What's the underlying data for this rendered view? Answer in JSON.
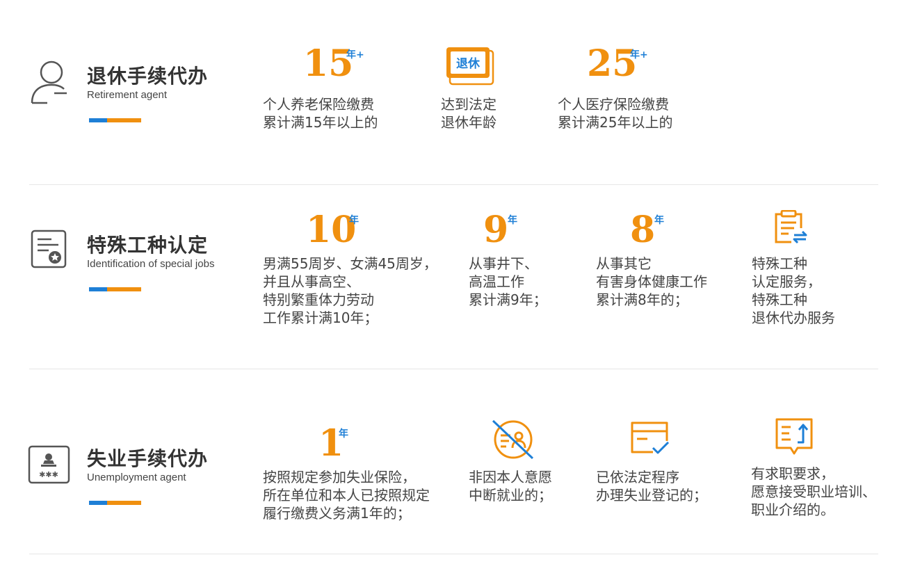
{
  "colors": {
    "orange": "#f0900f",
    "blue": "#1e7fd6",
    "icon_gray": "#555555"
  },
  "sections": [
    {
      "title": "退休手续代办",
      "subtitle": "Retirement agent",
      "icon": "person-minus-icon",
      "features": [
        {
          "number": "15",
          "suffix": "年+",
          "lines": [
            "个人养老保险缴费",
            "累计满15年以上的"
          ]
        },
        {
          "icon": "retirement-card-icon",
          "icon_text": "退休",
          "lines": [
            "达到法定",
            "退休年龄"
          ]
        },
        {
          "number": "25",
          "suffix": "年+",
          "lines": [
            "个人医疗保险缴费",
            "累计满25年以上的"
          ]
        }
      ]
    },
    {
      "title": "特殊工种认定",
      "subtitle": "Identification of special jobs",
      "icon": "certificate-star-icon",
      "features": [
        {
          "number": "10",
          "suffix": "年",
          "lines": [
            "男满55周岁、女满45周岁，",
            "并且从事高空、",
            "特别繁重体力劳动",
            "工作累计满10年；"
          ]
        },
        {
          "number": "9",
          "suffix": "年",
          "lines": [
            "从事井下、",
            "高温工作",
            "累计满9年；"
          ]
        },
        {
          "number": "8",
          "suffix": "年",
          "lines": [
            "从事其它",
            "有害身体健康工作",
            "累计满8年的；"
          ]
        },
        {
          "icon": "clipboard-transfer-icon",
          "lines": [
            "特殊工种",
            "认定服务，",
            "特殊工种",
            "退休代办服务"
          ]
        }
      ]
    },
    {
      "title": "失业手续代办",
      "subtitle": "Unemployment agent",
      "icon": "id-card-stars-icon",
      "features": [
        {
          "number": "1",
          "suffix": "年",
          "lines": [
            "按照规定参加失业保险，",
            "所在单位和本人已按照规定",
            "履行缴费义务满1年的；"
          ]
        },
        {
          "icon": "no-person-card-icon",
          "lines": [
            "非因本人意愿",
            "中断就业的；"
          ]
        },
        {
          "icon": "card-check-icon",
          "lines": [
            "已依法定程序",
            "办理失业登记的；"
          ]
        },
        {
          "icon": "document-upload-icon",
          "lines": [
            "有求职要求，",
            "愿意接受职业培训、",
            "职业介绍的。"
          ]
        }
      ]
    }
  ]
}
